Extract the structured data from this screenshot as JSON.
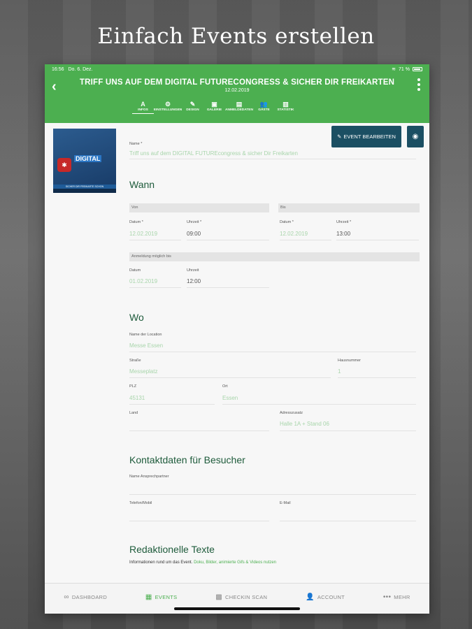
{
  "headline": "Einfach Events erstellen",
  "status": {
    "time": "16:56",
    "date": "Do. 6. Dez.",
    "battery": "71 %"
  },
  "appbar": {
    "title": "TRIFF UNS AUF DEM DIGITAL FUTURECONGRESS & SICHER DIR FREIKARTEN",
    "date": "12.02.2019",
    "tabs": [
      {
        "label": "INFOS",
        "icon": "A"
      },
      {
        "label": "EINSTELLUNGEN",
        "icon": "⚙"
      },
      {
        "label": "DESIGN",
        "icon": "✎"
      },
      {
        "label": "GALERIE",
        "icon": "▣"
      },
      {
        "label": "ANMELDEDATEN",
        "icon": "▤"
      },
      {
        "label": "GÄSTE",
        "icon": "👥"
      },
      {
        "label": "STATISTIK",
        "icon": "▥"
      }
    ]
  },
  "poster": {
    "title": "DIGITAL",
    "badge": "✱",
    "footer": "SICHER DIR FREIKARTE SCHON"
  },
  "actions": {
    "edit_label": "EVENT BEARBEITEN",
    "edit_icon": "✎",
    "view_icon": "◉"
  },
  "form": {
    "name_label": "Name *",
    "name_value": "Triff uns auf dem DIGITAL FUTUREcongress & sicher Dir Freikarten",
    "wann_heading": "Wann",
    "von_label": "Von",
    "bis_label": "Bis",
    "datum_label": "Datum *",
    "uhrzeit_label": "Uhrzeit *",
    "von_datum": "12.02.2019",
    "von_uhrzeit": "09:00",
    "bis_datum": "12.02.2019",
    "bis_uhrzeit": "13:00",
    "anmeldung_label": "Anmeldung möglich bis",
    "anm_datum_label": "Datum",
    "anm_uhrzeit_label": "Uhrzeit",
    "anm_datum": "01.02.2019",
    "anm_uhrzeit": "12:00",
    "wo_heading": "Wo",
    "location_label": "Name der Location",
    "location_value": "Messe Essen",
    "strasse_label": "Straße",
    "strasse_value": "Messeplatz",
    "hausnummer_label": "Hausnummer",
    "hausnummer_value": "1",
    "plz_label": "PLZ",
    "plz_value": "45131",
    "ort_label": "Ort",
    "ort_value": "Essen",
    "land_label": "Land",
    "adresszusatz_label": "Adresszusatz",
    "adresszusatz_value": "Halle 1A + Stand 06",
    "kontakt_heading": "Kontaktdaten für Besucher",
    "ansprechpartner_label": "Name Ansprechpartner",
    "telefon_label": "Telefon/Mobil",
    "email_label": "E-Mail",
    "redaktion_heading": "Redaktionelle Texte",
    "redaktion_info": "Informationen rund um das Event.",
    "redaktion_info_link": "Doku, Bilder, animierte Gifs & Videos nutzen"
  },
  "bottomnav": [
    {
      "label": "DASHBOARD",
      "icon": "∞"
    },
    {
      "label": "EVENTS",
      "icon": "▦"
    },
    {
      "label": "CHECKIN SCAN",
      "icon": "▩"
    },
    {
      "label": "ACCOUNT",
      "icon": "👤"
    },
    {
      "label": "MEHR",
      "icon": "•••"
    }
  ]
}
